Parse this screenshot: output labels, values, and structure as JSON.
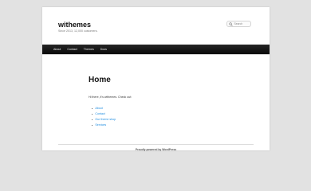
{
  "header": {
    "site_title": "withemes",
    "site_description": "Since 2013, 12,000 customers.",
    "search_placeholder": "Search",
    "search_icon": "search-icon"
  },
  "nav": {
    "items": [
      "About",
      "Contact",
      "Themes",
      "Docs"
    ]
  },
  "content": {
    "title": "Home",
    "intro": "Hi there, it's withemes. Check out:",
    "links": [
      "About",
      "Contact",
      "Our theme shop",
      "Services"
    ]
  },
  "footer": {
    "credit": "Proudly powered by WordPress"
  },
  "colors": {
    "background": "#e2e2e2",
    "nav_bar": "#1a1a1a",
    "link": "#1b8be0"
  }
}
